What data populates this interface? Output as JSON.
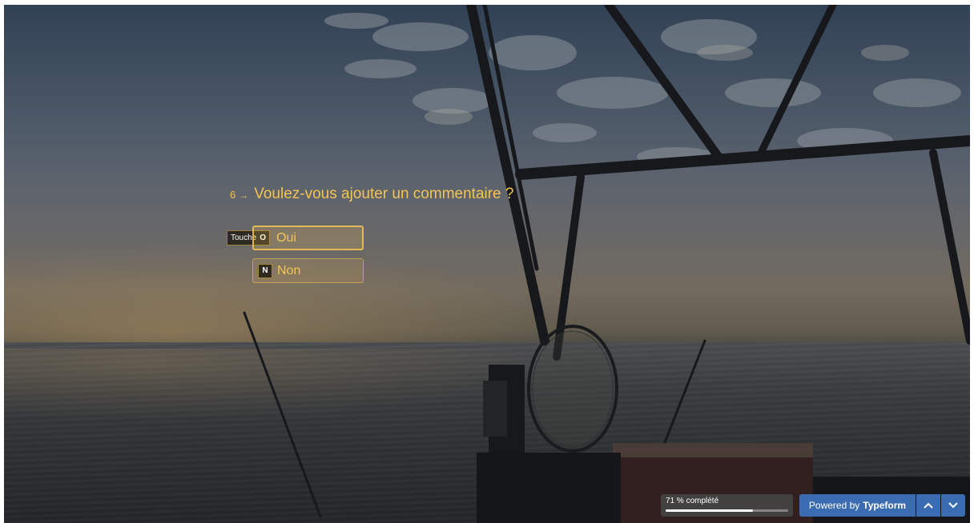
{
  "question": {
    "number": "6",
    "arrow": "→",
    "text": "Voulez-vous ajouter un commentaire ?"
  },
  "choices": [
    {
      "key": "O",
      "label": "Oui",
      "selected": true
    },
    {
      "key": "N",
      "label": "Non",
      "selected": false
    }
  ],
  "key_hint": {
    "prefix": "Touche",
    "key": "O"
  },
  "progress": {
    "label": "71 % complété",
    "value": 0.71
  },
  "branding": {
    "prefix": "Powered by",
    "name": "Typeform"
  },
  "nav": {
    "up_icon": "chevron-up-icon",
    "down_icon": "chevron-down-icon"
  },
  "colors": {
    "accent": "#f4c453",
    "brand_blue": "#3b6bb0"
  }
}
